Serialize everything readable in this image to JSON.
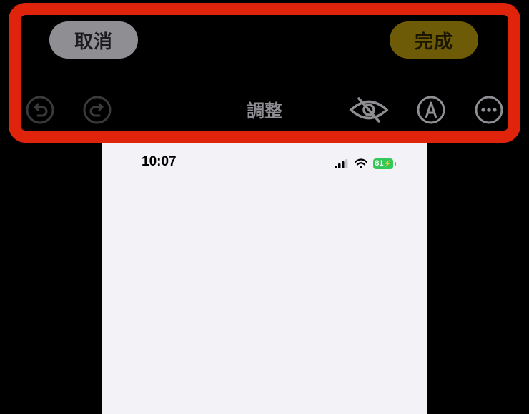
{
  "toolbar": {
    "cancel_label": "取消",
    "done_label": "完成",
    "mode_title": "調整",
    "icons": [
      "undo-icon",
      "redo-icon",
      "hide-eye-icon",
      "markup-pen-icon",
      "more-icon"
    ]
  },
  "status_bar": {
    "time": "10:07",
    "battery_level": "81",
    "battery_color": "#34c759"
  },
  "colors": {
    "highlight": "#e0230b",
    "done_button": "#6e5b08",
    "cancel_button": "#8e8e93"
  }
}
